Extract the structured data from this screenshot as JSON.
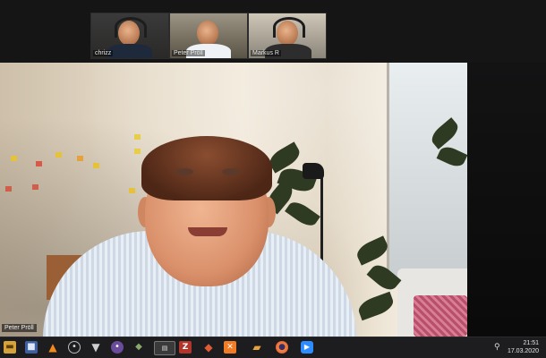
{
  "meeting": {
    "participants": [
      {
        "name": "chrizz"
      },
      {
        "name": "Peter Pröll"
      },
      {
        "name": "Markus R"
      }
    ],
    "active_speaker": {
      "name": "Peter Pröll"
    }
  },
  "taskbar": {
    "apps": [
      {
        "icon": "folder-icon"
      },
      {
        "icon": "save-disk-icon"
      },
      {
        "icon": "vlc-icon"
      },
      {
        "icon": "obs-icon"
      },
      {
        "icon": "inkscape-icon"
      },
      {
        "icon": "gimp-icon"
      },
      {
        "icon": "game-icon"
      },
      {
        "icon": "terminal-icon"
      },
      {
        "icon": "filezilla-icon"
      },
      {
        "icon": "git-icon"
      },
      {
        "icon": "xampp-icon"
      },
      {
        "icon": "bag-icon"
      },
      {
        "icon": "firefox-icon"
      },
      {
        "icon": "zoom-icon"
      }
    ],
    "clock": {
      "time": "21:51",
      "date": "17.03.2020"
    }
  }
}
